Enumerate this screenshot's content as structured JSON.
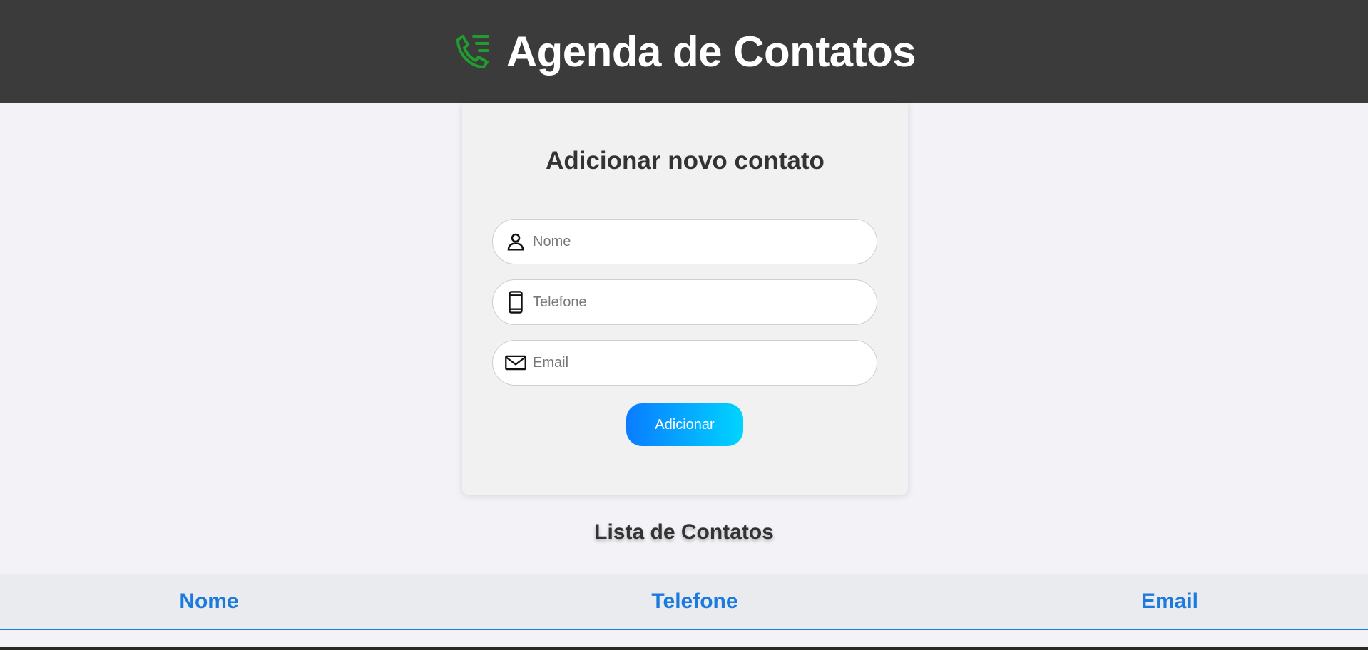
{
  "header": {
    "title": "Agenda de Contatos",
    "logo_icon": "phone-list-icon",
    "logo_color": "#1f9d2e"
  },
  "form": {
    "title": "Adicionar novo contato",
    "fields": [
      {
        "icon": "person-icon",
        "placeholder": "Nome",
        "value": ""
      },
      {
        "icon": "smartphone-icon",
        "placeholder": "Telefone",
        "value": ""
      },
      {
        "icon": "mail-icon",
        "placeholder": "Email",
        "value": ""
      }
    ],
    "submit_label": "Adicionar",
    "accent_from": "#0a7cff",
    "accent_to": "#00d4ff"
  },
  "list": {
    "title": "Lista de Contatos",
    "columns": [
      "Nome",
      "Telefone",
      "Email"
    ],
    "rows": [],
    "header_color": "#1a7ae0"
  }
}
